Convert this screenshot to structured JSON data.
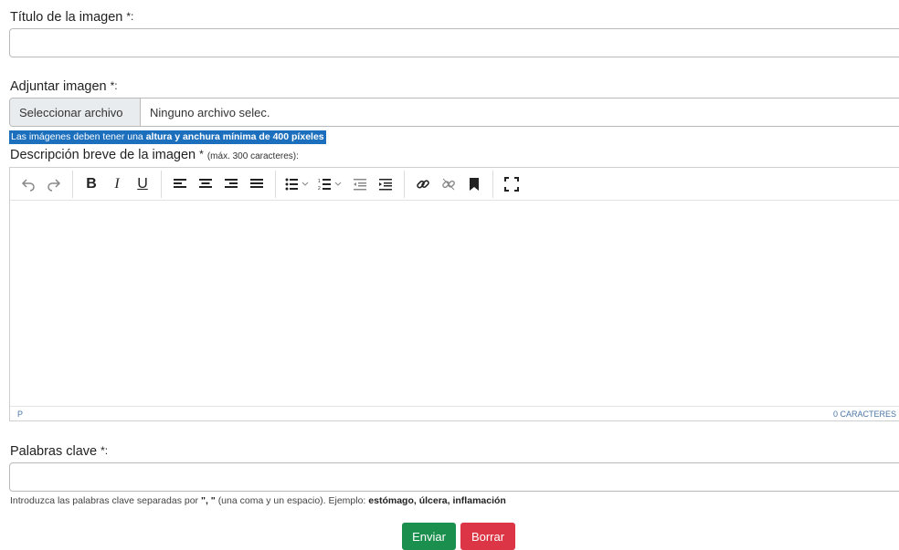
{
  "title_field": {
    "label": "Título de la imagen",
    "required_mark": "*:",
    "value": ""
  },
  "attach": {
    "label": "Adjuntar imagen",
    "required_mark": "*:",
    "button_label": "Seleccionar archivo",
    "file_name": "Ninguno archivo selec.",
    "info_prefix": "Las imágenes deben tener una",
    "info_bold": "altura y anchura mínima de 400 píxeles"
  },
  "description": {
    "label": "Descripción breve de la imagen",
    "required_mark": "*",
    "note": "(máx. 300 caracteres):",
    "status_path": "P",
    "char_count": "0 CARACTERES",
    "toolbar": [
      "undo-icon",
      "redo-icon",
      "bold-icon",
      "italic-icon",
      "underline-icon",
      "align-left-icon",
      "align-center-icon",
      "align-right-icon",
      "align-justify-icon",
      "bullet-list-icon",
      "numbered-list-icon",
      "outdent-icon",
      "indent-icon",
      "link-icon",
      "unlink-icon",
      "bookmark-icon",
      "fullscreen-icon"
    ]
  },
  "keywords": {
    "label": "Palabras clave",
    "required_mark": "*:",
    "value": "",
    "hint_prefix": "Introduzca las palabras clave separadas por",
    "hint_separator": "\", \"",
    "hint_middle": "(una coma y un espacio). Ejemplo:",
    "hint_example": "estómago, úlcera, inflamación"
  },
  "buttons": {
    "submit": "Enviar",
    "reset": "Borrar"
  },
  "colors": {
    "submit": "#1b8f4d",
    "reset": "#dc3545",
    "info_bg": "#1b6fbd"
  }
}
